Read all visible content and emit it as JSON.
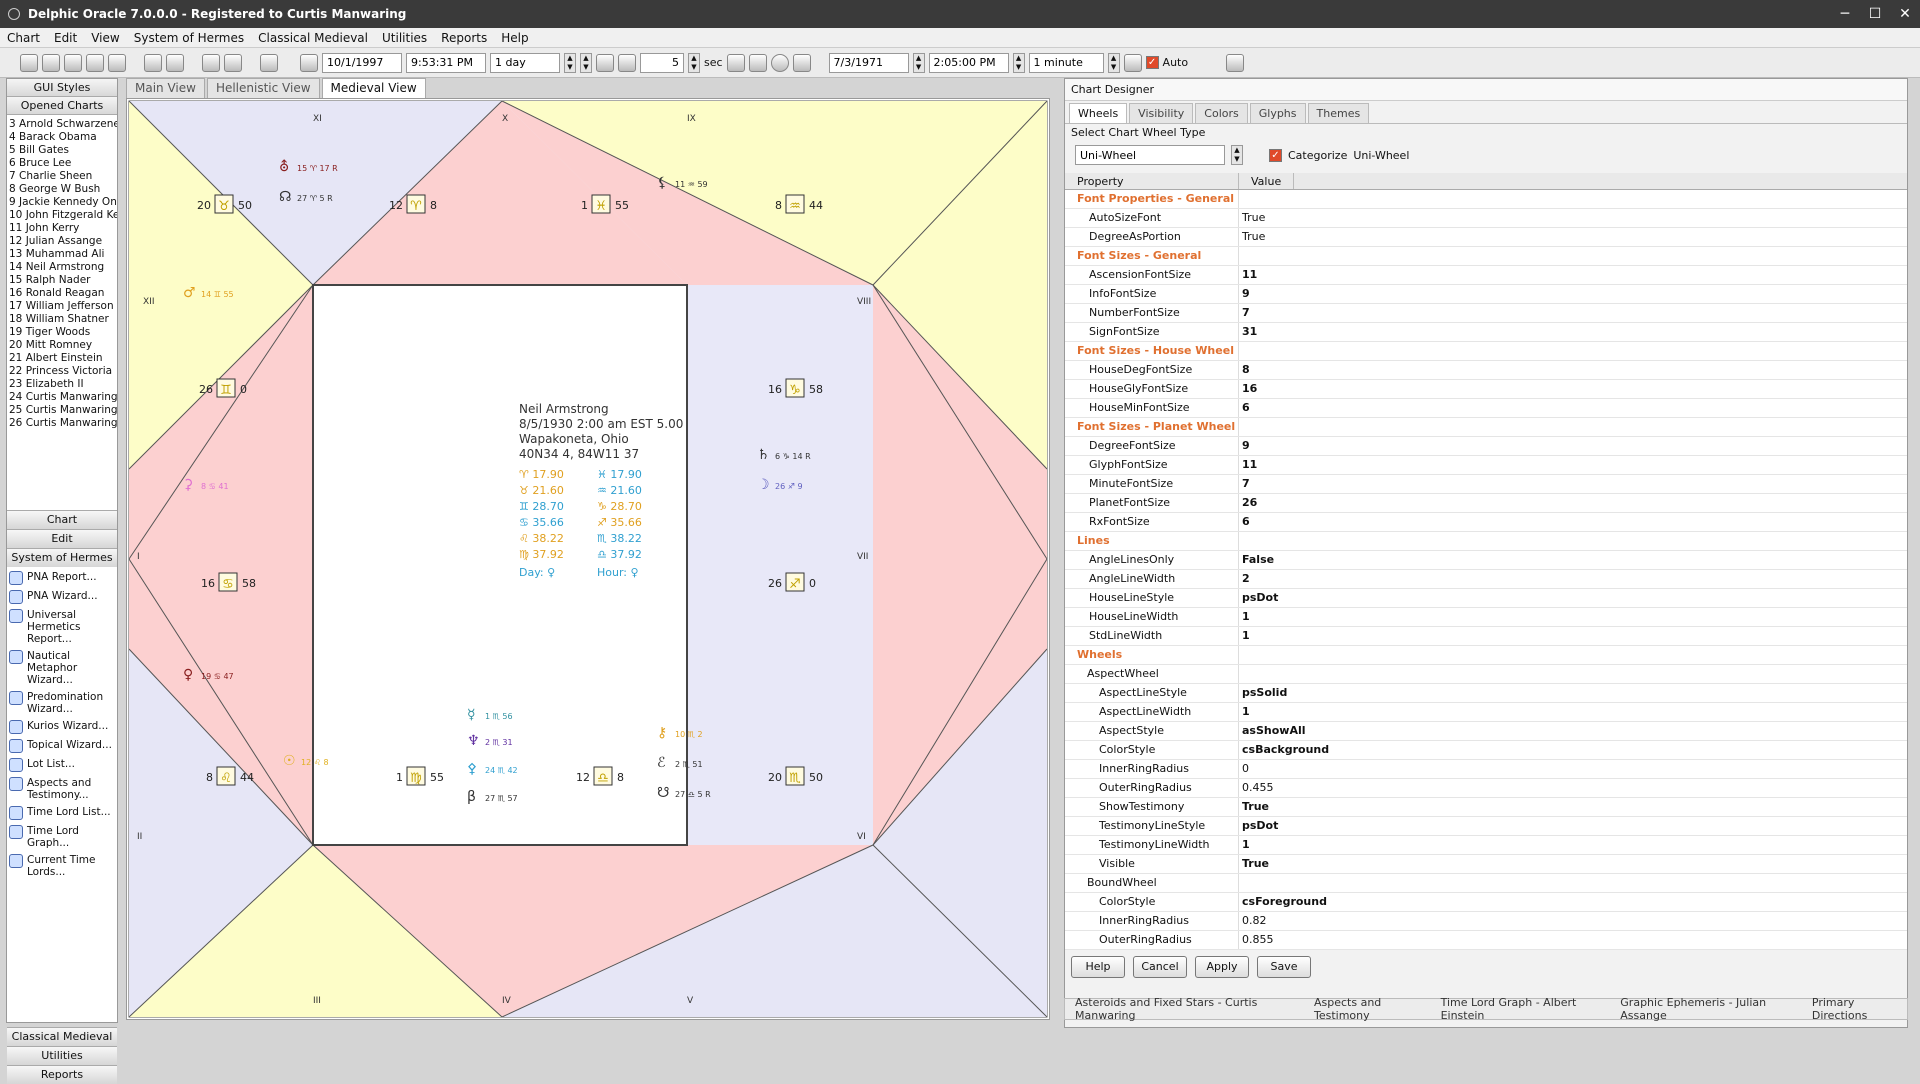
{
  "app": {
    "title": "Delphic Oracle 7.0.0.0  -  Registered to Curtis Manwaring",
    "min": "─",
    "max": "☐",
    "close": "✕"
  },
  "menu": [
    "Chart",
    "Edit",
    "View",
    "System of Hermes",
    "Classical Medieval",
    "Utilities",
    "Reports",
    "Help"
  ],
  "toolbar": {
    "date1": "10/1/1997",
    "time1": "9:53:31 PM",
    "step1": "1 day",
    "count": "5",
    "sec": "sec",
    "date2": "7/3/1971",
    "time2": "2:05:00 PM",
    "step2": "1 minute",
    "auto": "Auto"
  },
  "left": {
    "gui_styles": "GUI Styles",
    "opened_charts": "Opened Charts",
    "charts": [
      "3 Arnold Schwarzeneg",
      "4 Barack Obama",
      "5 Bill Gates",
      "6 Bruce Lee",
      "7 Charlie Sheen",
      "8 George W Bush",
      "9 Jackie Kennedy Ona",
      "10 John Fitzgerald Ker",
      "11 John Kerry",
      "12 Julian Assange",
      "13 Muhammad Ali",
      "14 Neil Armstrong",
      "15 Ralph Nader",
      "16 Ronald Reagan",
      "17 William Jefferson C",
      "18 William Shatner",
      "19 Tiger Woods",
      "20 Mitt Romney",
      "21 Albert Einstein",
      "22 Princess Victoria",
      "23 Elizabeth II",
      "24 Curtis Manwaring",
      "25 Curtis Manwaring L",
      "26 Curtis Manwaring L"
    ],
    "cats": [
      "Chart",
      "Edit",
      "System of Hermes"
    ],
    "tools": [
      "PNA Report...",
      "PNA Wizard...",
      "Universal Hermetics Report...",
      "Nautical Metaphor Wizard...",
      "Predomination Wizard...",
      "Kurios Wizard...",
      "Topical Wizard...",
      "Lot List...",
      "Aspects and Testimony...",
      "Time Lord List...",
      "Time Lord Graph...",
      "Current Time Lords..."
    ],
    "bottom_cats": [
      "Classical Medieval",
      "Utilities",
      "Reports"
    ]
  },
  "tabs": [
    "Main View",
    "Hellenistic View",
    "Medieval View"
  ],
  "chart": {
    "houses": [
      "I",
      "II",
      "III",
      "IV",
      "V",
      "VI",
      "VII",
      "VIII",
      "IX",
      "X",
      "XI",
      "XII"
    ],
    "cusps": [
      {
        "deg": "20",
        "glyph": "♉",
        "min": "50"
      },
      {
        "deg": "12",
        "glyph": "♈",
        "min": "8"
      },
      {
        "deg": "1",
        "glyph": "♓",
        "min": "55"
      },
      {
        "deg": "8",
        "glyph": "♒",
        "min": "44"
      },
      {
        "deg": "26",
        "glyph": "♊",
        "min": "0"
      },
      {
        "deg": "16",
        "glyph": "♑",
        "min": "58"
      },
      {
        "deg": "16",
        "glyph": "♋",
        "min": "58"
      },
      {
        "deg": "26",
        "glyph": "♐",
        "min": "0"
      },
      {
        "deg": "8",
        "glyph": "♌",
        "min": "44"
      },
      {
        "deg": "1",
        "glyph": "♍",
        "min": "55"
      },
      {
        "deg": "12",
        "glyph": "♎",
        "min": "8"
      },
      {
        "deg": "20",
        "glyph": "♏",
        "min": "50"
      }
    ],
    "planets": [
      {
        "g": "⛢",
        "t": "15 ♈ 17 R",
        "c": "#8a2020"
      },
      {
        "g": "☊",
        "t": "27 ♈ 5 R",
        "c": "#333"
      },
      {
        "g": "⚸",
        "t": "11 ♒ 59",
        "c": "#333"
      },
      {
        "g": "♂",
        "t": "14 ♊ 55",
        "c": "#e0a020"
      },
      {
        "g": "⚳",
        "t": "8 ♋ 41",
        "c": "#e070d0"
      },
      {
        "g": "♀",
        "t": "19 ♋ 47",
        "c": "#8a2020"
      },
      {
        "g": "♄",
        "t": "6 ♑ 14 R",
        "c": "#333"
      },
      {
        "g": "☽",
        "t": "26 ♐ 9",
        "c": "#6060c0"
      },
      {
        "g": "☉",
        "t": "12 ♌ 8",
        "c": "#e0b020"
      },
      {
        "g": "☿",
        "t": "1 ♏ 56",
        "c": "#3090a0"
      },
      {
        "g": "♆",
        "t": "2 ♏ 31",
        "c": "#6030a0"
      },
      {
        "g": "⚴",
        "t": "24 ♏ 42",
        "c": "#30a0d0"
      },
      {
        "g": "β",
        "t": "27 ♏ 57",
        "c": "#333"
      },
      {
        "g": "⚷",
        "t": "10 ♏ 2",
        "c": "#e0a020"
      },
      {
        "g": "ℰ",
        "t": "2 ♏ 51",
        "c": "#333"
      },
      {
        "g": "☋",
        "t": "27 ♎ 5 R",
        "c": "#333"
      }
    ],
    "info": {
      "name": "Neil Armstrong",
      "date": "8/5/1930  2:00 am  EST 5.00",
      "place": "Wapakoneta, Ohio",
      "coords": "40N34 4,  84W11 37",
      "left": [
        "♈  17.90",
        "♉  21.60",
        "♊  28.70",
        "♋  35.66",
        "♌  38.22",
        "♍  37.92"
      ],
      "right": [
        "♓  17.90",
        "♒  21.60",
        "♑  28.70",
        "♐  35.66",
        "♏  38.22",
        "♎  37.92"
      ],
      "day": "Day:   ♀",
      "hour": "Hour:  ♀"
    }
  },
  "designer": {
    "title": "Chart Designer",
    "tabs": [
      "Wheels",
      "Visibility",
      "Colors",
      "Glyphs",
      "Themes"
    ],
    "select_label": "Select Chart Wheel Type",
    "wheel_type": "Uni-Wheel",
    "categorize": "Categorize",
    "cat_value": "Uni-Wheel",
    "col_property": "Property",
    "col_value": "Value",
    "rows": [
      {
        "k": "Font Properties - General",
        "s": 1
      },
      {
        "k": "AutoSizeFont",
        "v": "True",
        "n": 1
      },
      {
        "k": "DegreeAsPortion",
        "v": "True",
        "n": 1
      },
      {
        "k": "Font Sizes - General",
        "s": 1
      },
      {
        "k": "AscensionFontSize",
        "v": "11"
      },
      {
        "k": "InfoFontSize",
        "v": "9"
      },
      {
        "k": "NumberFontSize",
        "v": "7"
      },
      {
        "k": "SignFontSize",
        "v": "31"
      },
      {
        "k": "Font Sizes - House Wheel",
        "s": 1
      },
      {
        "k": "HouseDegFontSize",
        "v": "8"
      },
      {
        "k": "HouseGlyFontSize",
        "v": "16"
      },
      {
        "k": "HouseMinFontSize",
        "v": "6"
      },
      {
        "k": "Font Sizes - Planet Wheel",
        "s": 1
      },
      {
        "k": "DegreeFontSize",
        "v": "9"
      },
      {
        "k": "GlyphFontSize",
        "v": "11"
      },
      {
        "k": "MinuteFontSize",
        "v": "7"
      },
      {
        "k": "PlanetFontSize",
        "v": "26"
      },
      {
        "k": "RxFontSize",
        "v": "6"
      },
      {
        "k": "Lines",
        "s": 1
      },
      {
        "k": "AngleLinesOnly",
        "v": "False"
      },
      {
        "k": "AngleLineWidth",
        "v": "2"
      },
      {
        "k": "HouseLineStyle",
        "v": "psDot"
      },
      {
        "k": "HouseLineWidth",
        "v": "1"
      },
      {
        "k": "StdLineWidth",
        "v": "1"
      },
      {
        "k": "Wheels",
        "s": 1
      },
      {
        "k": "AspectWheel",
        "sub": 1
      },
      {
        "k": "AspectLineStyle",
        "v": "psSolid",
        "d": 1
      },
      {
        "k": "AspectLineWidth",
        "v": "1",
        "d": 1
      },
      {
        "k": "AspectStyle",
        "v": "asShowAll",
        "d": 1
      },
      {
        "k": "ColorStyle",
        "v": "csBackground",
        "d": 1
      },
      {
        "k": "InnerRingRadius",
        "v": "0",
        "d": 1,
        "n": 1
      },
      {
        "k": "OuterRingRadius",
        "v": "0.455",
        "d": 1,
        "n": 1
      },
      {
        "k": "ShowTestimony",
        "v": "True",
        "d": 1
      },
      {
        "k": "TestimonyLineStyle",
        "v": "psDot",
        "d": 1
      },
      {
        "k": "TestimonyLineWidth",
        "v": "1",
        "d": 1
      },
      {
        "k": "Visible",
        "v": "True",
        "d": 1
      },
      {
        "k": "BoundWheel",
        "sub": 1
      },
      {
        "k": "ColorStyle",
        "v": "csForeground",
        "d": 1
      },
      {
        "k": "InnerRingRadius",
        "v": "0.82",
        "d": 1,
        "n": 1
      },
      {
        "k": "OuterRingRadius",
        "v": "0.855",
        "d": 1,
        "n": 1
      }
    ],
    "buttons": [
      "Help",
      "Cancel",
      "Apply",
      "Save"
    ]
  },
  "bottom_tabs": [
    "Asteroids and Fixed Stars - Curtis Manwaring",
    "Aspects and Testimony",
    "Time Lord Graph - Albert Einstein",
    "Graphic Ephemeris - Julian Assange",
    "Primary Directions"
  ]
}
